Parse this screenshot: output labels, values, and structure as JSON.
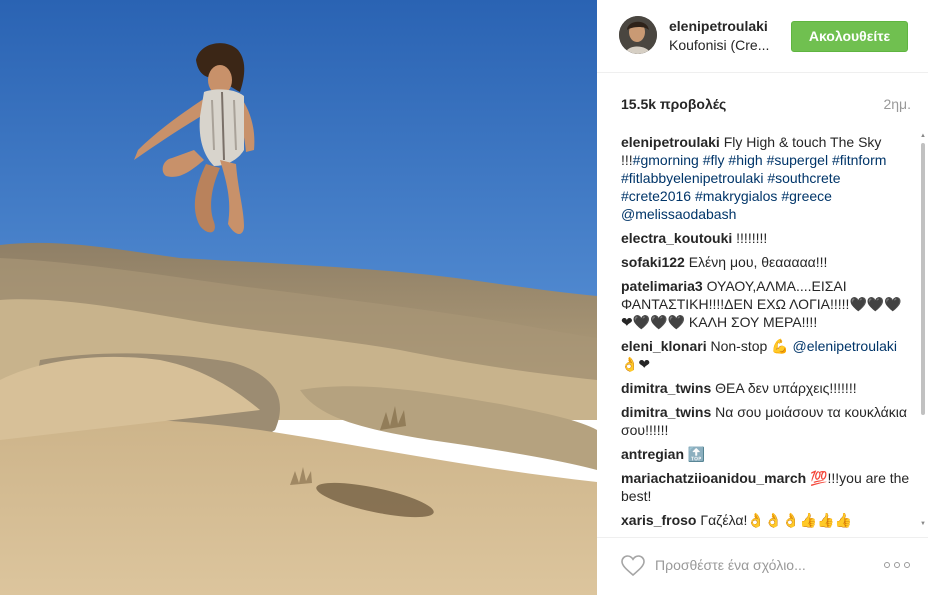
{
  "post": {
    "username": "elenipetroulaki",
    "location": "Koufonisi (Cre...",
    "follow_label": "Ακολουθείτε",
    "views": "15.5k προβολές",
    "time_ago": "2ημ."
  },
  "caption": {
    "user": "elenipetroulaki",
    "segments": [
      {
        "type": "text",
        "value": "Fly High & touch The Sky !!!"
      },
      {
        "type": "hashtag",
        "value": "#gmorning"
      },
      {
        "type": "text",
        "value": " "
      },
      {
        "type": "hashtag",
        "value": "#fly"
      },
      {
        "type": "text",
        "value": " "
      },
      {
        "type": "hashtag",
        "value": "#high"
      },
      {
        "type": "text",
        "value": " "
      },
      {
        "type": "hashtag",
        "value": "#supergel"
      },
      {
        "type": "text",
        "value": " "
      },
      {
        "type": "hashtag",
        "value": "#fitnform"
      },
      {
        "type": "text",
        "value": " "
      },
      {
        "type": "hashtag",
        "value": "#fitlabbyelenipetroulaki"
      },
      {
        "type": "text",
        "value": " "
      },
      {
        "type": "hashtag",
        "value": "#southcrete"
      },
      {
        "type": "text",
        "value": " "
      },
      {
        "type": "hashtag",
        "value": "#crete2016"
      },
      {
        "type": "text",
        "value": " "
      },
      {
        "type": "hashtag",
        "value": "#makrygialos"
      },
      {
        "type": "text",
        "value": " "
      },
      {
        "type": "hashtag",
        "value": "#greece"
      },
      {
        "type": "text",
        "value": " "
      },
      {
        "type": "mention",
        "value": "@melissaodabash"
      }
    ]
  },
  "comments": [
    {
      "user": "electra_koutouki",
      "text": "!!!!!!!!"
    },
    {
      "user": "sofaki122",
      "text": "Ελένη μου, θεααααα!!!"
    },
    {
      "user": "patelimaria3",
      "text": "ΟΥΑΟΥ,ΑΛΜΑ....ΕΙΣΑΙ ΦΑΝΤΑΣΤΙΚΗ!!!!ΔΕΝ ΕΧΩ ΛΟΓΙΑ!!!!!🖤🖤🖤❤🖤🖤🖤 ΚΑΛΗ ΣΟΥ ΜΕΡΑ!!!!"
    },
    {
      "user": "eleni_klonari",
      "text": "Non-stop 💪",
      "mention": "@elenipetroulaki",
      "after": " 👌❤"
    },
    {
      "user": "dimitra_twins",
      "text": "ΘΕΑ δεν υπάρχεις!!!!!!!"
    },
    {
      "user": "dimitra_twins",
      "text": "Να σου μοιάσουν τα κουκλάκια σου!!!!!!"
    },
    {
      "user": "antregian",
      "text": "🔝"
    },
    {
      "user": "mariachatziioanidou_march",
      "text": "💯!!!you are the best!"
    },
    {
      "user": "xaris_froso",
      "text": "Γαζέλα!👌👌👌👍👍👍"
    }
  ],
  "footer": {
    "comment_placeholder": "Προσθέστε ένα σχόλιο...",
    "like_icon": "heart-outline-icon",
    "more_icon": "more-options-icon"
  },
  "colors": {
    "follow_button": "#70c050",
    "hashtag": "#003569",
    "sky": "#2f6ab8"
  }
}
